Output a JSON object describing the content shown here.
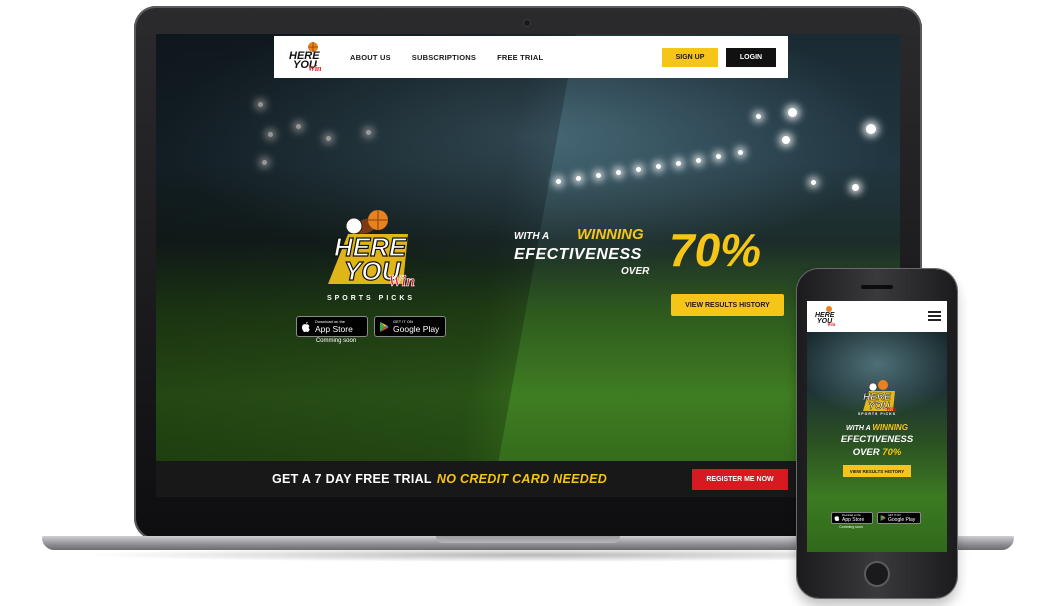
{
  "colors": {
    "accent_yellow": "#f5c518",
    "register_red": "#d71920",
    "nav_bg": "#ffffff",
    "trial_bar_bg": "#181818"
  },
  "brand": {
    "logo_line1": "HERE",
    "logo_line2": "YOU",
    "logo_script": "Win",
    "subtitle": "SPORTS PICKS"
  },
  "nav": {
    "links": [
      "ABOUT US",
      "SUBSCRIPTIONS",
      "FREE TRIAL"
    ],
    "signup_label": "SIGN UP",
    "login_label": "LOGIN"
  },
  "hero": {
    "with_a": "WITH A",
    "winning": "WINNING",
    "effectiveness": "EFECTIVENESS",
    "over": "OVER",
    "percent": "70%",
    "results_button": "VIEW RESULTS HISTORY"
  },
  "app_badges": {
    "apple_small": "Download on the",
    "apple_big": "App Store",
    "google_small": "GET IT ON",
    "google_big": "Google Play",
    "coming_soon": "Comming soon"
  },
  "trial": {
    "text": "GET A 7 DAY FREE TRIAL",
    "emphasis": "NO CREDIT CARD NEEDED",
    "register_button": "REGISTER ME NOW"
  },
  "mobile": {
    "with_a": "WITH A",
    "winning": "WINNING",
    "effectiveness": "EFECTIVENESS",
    "over": "OVER",
    "percent": "70%",
    "results_button": "VIEW RESULTS HISTORY",
    "subtitle": "SPORTS PICKS",
    "coming_soon": "Comming soon"
  },
  "icons": [
    "apple-icon",
    "google-play-icon",
    "hamburger-menu-icon",
    "brand-logo"
  ]
}
